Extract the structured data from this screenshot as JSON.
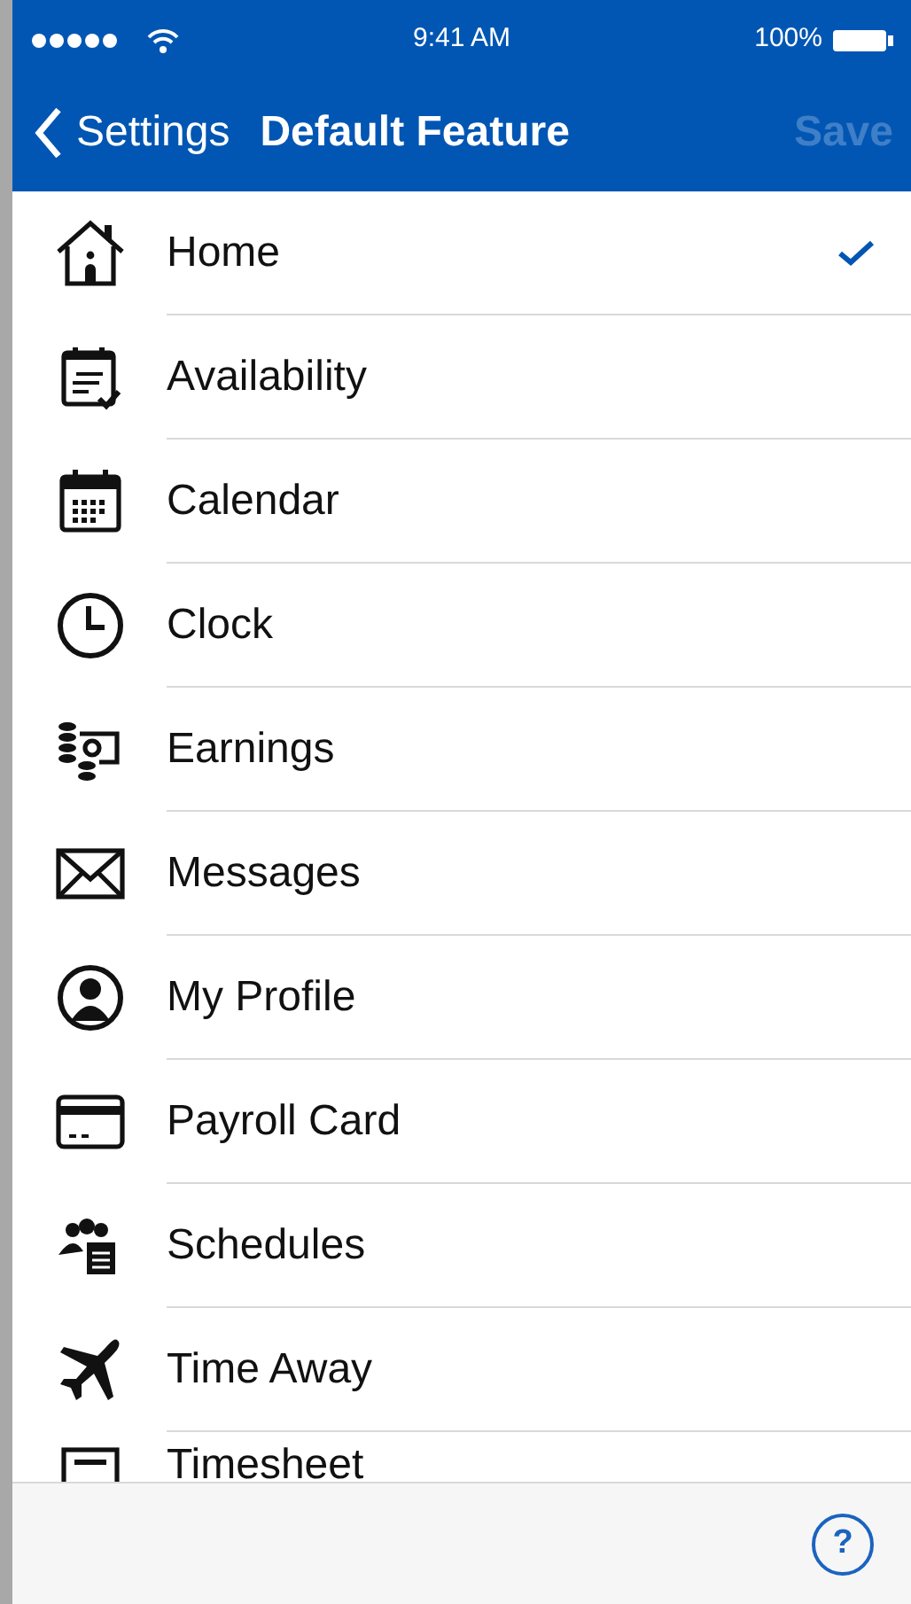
{
  "status_bar": {
    "time": "9:41 AM",
    "battery": "100%"
  },
  "nav_bar": {
    "back": "Settings",
    "title": "Default Feature",
    "action": {
      "label": "Save",
      "disabled": true
    }
  },
  "features": [
    {
      "label": "Home",
      "selected": true
    },
    {
      "label": "Availability",
      "selected": false
    },
    {
      "label": "Calendar",
      "selected": false
    },
    {
      "label": "Clock",
      "selected": false
    },
    {
      "label": "Earnings",
      "selected": false
    },
    {
      "label": "Messages",
      "selected": false
    },
    {
      "label": "My Profile",
      "selected": false
    },
    {
      "label": "Payroll Card",
      "selected": false
    },
    {
      "label": "Schedules",
      "selected": false
    },
    {
      "label": "Time Away",
      "selected": false
    },
    {
      "label": "Timesheet",
      "selected": false
    }
  ],
  "footer": {
    "help": "?"
  }
}
